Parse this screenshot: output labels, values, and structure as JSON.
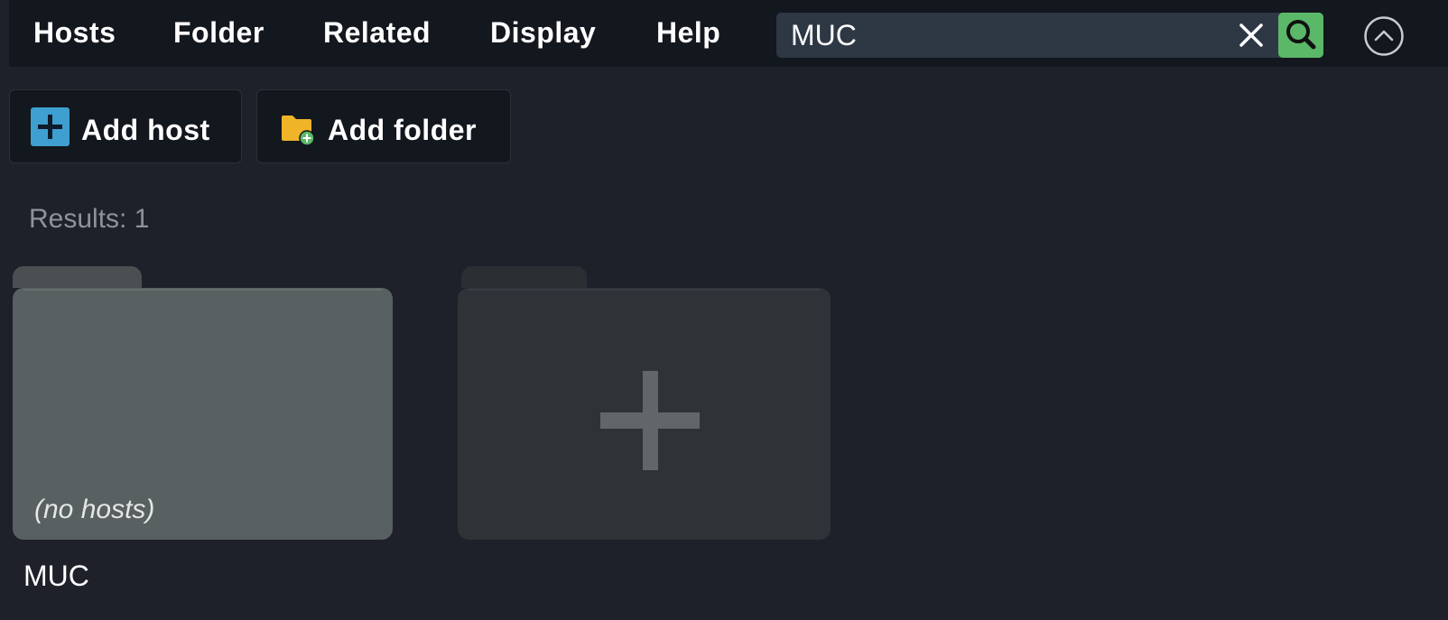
{
  "menu": {
    "items": [
      {
        "label": "Hosts"
      },
      {
        "label": "Folder"
      },
      {
        "label": "Related"
      },
      {
        "label": "Display"
      },
      {
        "label": "Help"
      }
    ]
  },
  "search": {
    "value": "MUC",
    "clear_icon": "close-icon",
    "search_icon": "search-icon"
  },
  "collapse_icon": "chevron-up-circle-icon",
  "toolbar": {
    "add_host_label": "Add host",
    "add_folder_label": "Add folder"
  },
  "results_label": "Results: 1",
  "folders": [
    {
      "name": "MUC",
      "status": "(no hosts)"
    }
  ],
  "colors": {
    "background": "#1e2129",
    "menubar": "#13171e",
    "search_bg": "#2e3744",
    "search_button": "#5bb868",
    "add_host_icon": "#3f9fd1",
    "add_folder_icon": "#f0b429",
    "folder_tile": "#586061",
    "new_folder_tile": "#2e3338"
  }
}
